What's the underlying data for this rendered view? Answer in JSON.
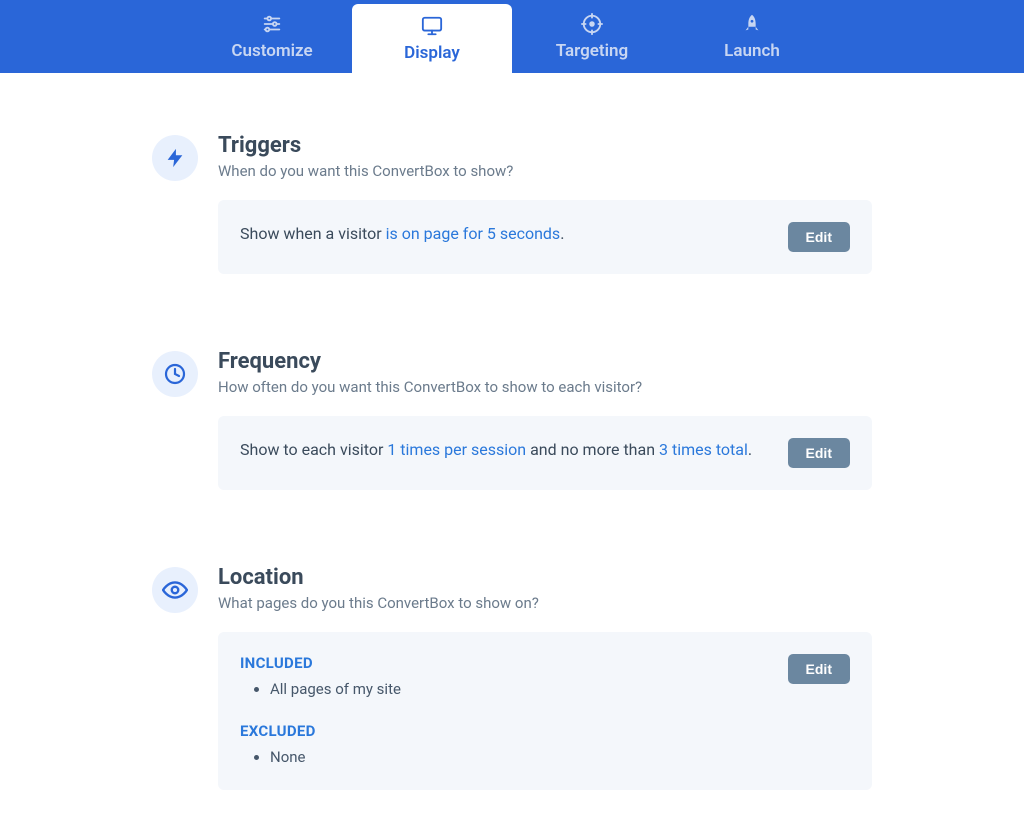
{
  "tabs": [
    {
      "id": "customize",
      "label": "Customize",
      "active": false
    },
    {
      "id": "display",
      "label": "Display",
      "active": true
    },
    {
      "id": "targeting",
      "label": "Targeting",
      "active": false
    },
    {
      "id": "launch",
      "label": "Launch",
      "active": false
    }
  ],
  "common": {
    "edit_label": "Edit"
  },
  "sections": {
    "triggers": {
      "title": "Triggers",
      "subtitle": "When do you want this ConvertBox to show?",
      "text_parts": {
        "prefix": "Show when a visitor ",
        "highlight": "is on page for 5 seconds",
        "suffix": "."
      }
    },
    "frequency": {
      "title": "Frequency",
      "subtitle": "How often do you want this ConvertBox to show to each visitor?",
      "text_parts": {
        "prefix": "Show to each visitor ",
        "highlight1": "1 times per session",
        "middle": " and no more than ",
        "highlight2": "3 times total",
        "suffix": "."
      }
    },
    "location": {
      "title": "Location",
      "subtitle": "What pages do you this ConvertBox to show on?",
      "included_label": "INCLUDED",
      "included_items": [
        "All pages of my site"
      ],
      "excluded_label": "EXCLUDED",
      "excluded_items": [
        "None"
      ]
    }
  }
}
